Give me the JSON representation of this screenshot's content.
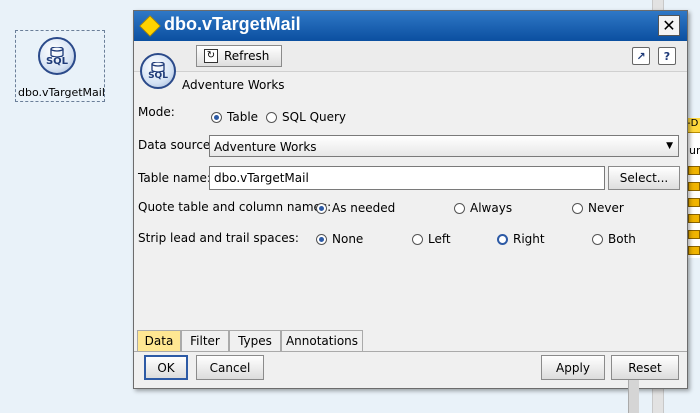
{
  "canvas": {
    "node_label": "dbo.vTargetMail",
    "node_icon_text": "SQL",
    "side_node_text": "-D",
    "side_node_label": "un"
  },
  "dialog": {
    "title": "dbo.vTargetMail",
    "close": "✕",
    "toolbar": {
      "refresh_label": "Refresh"
    },
    "node_icon_text": "SQL",
    "source_caption": "Adventure Works",
    "mode": {
      "label": "Mode:",
      "options": [
        "Table",
        "SQL Query"
      ],
      "selected": "Table"
    },
    "data_source": {
      "label": "Data source:",
      "value": "Adventure Works"
    },
    "table_name": {
      "label": "Table name:",
      "value": "dbo.vTargetMail",
      "button": "Select..."
    },
    "quote": {
      "label": "Quote table and column names:",
      "options": [
        "As needed",
        "Always",
        "Never"
      ],
      "selected": "As needed"
    },
    "strip": {
      "label": "Strip lead and trail spaces:",
      "options": [
        "None",
        "Left",
        "Right",
        "Both"
      ],
      "selected": "None"
    },
    "tabs": [
      "Data",
      "Filter",
      "Types",
      "Annotations"
    ],
    "active_tab": "Data",
    "buttons": {
      "ok": "OK",
      "cancel": "Cancel",
      "apply": "Apply",
      "reset": "Reset"
    }
  }
}
